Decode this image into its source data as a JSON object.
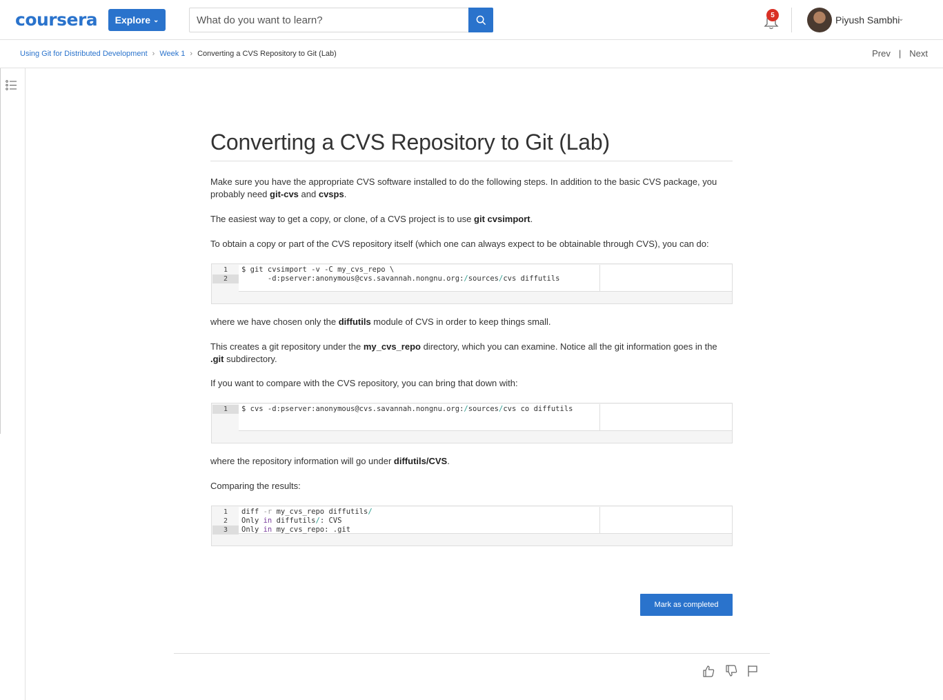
{
  "header": {
    "logo": "coursera",
    "explore_label": "Explore",
    "search_placeholder": "What do you want to learn?",
    "notifications_count": "5",
    "user_name": "Piyush Sambhi"
  },
  "breadcrumb": {
    "items": [
      "Using Git for Distributed Development",
      "Week 1"
    ],
    "current": "Converting a CVS Repository to Git (Lab)",
    "prev_label": "Prev",
    "separator": "|",
    "next_label": "Next"
  },
  "content": {
    "title": "Converting a CVS Repository to Git (Lab)",
    "p1_a": "Make sure you have the appropriate CVS software installed to do the following steps. In addition to the basic CVS package, you probably need ",
    "p1_b1": "git-cvs",
    "p1_c": " and ",
    "p1_b2": "cvsps",
    "p1_d": ".",
    "p2_a": "The easiest way to get a copy, or clone, of a CVS project is to use ",
    "p2_b": "git cvsimport",
    "p2_c": ".",
    "p3": "To obtain a copy or part of the CVS repository itself (which one can always expect to be obtainable through CVS), you can do:",
    "code1": {
      "line_numbers": [
        "1",
        "2"
      ],
      "line1": "$ git cvsimport -v -C my_cvs_repo \\",
      "line2_a": "      -d:pserver:anonymous@cvs.savannah.nongnu.org:",
      "line2_b": "/",
      "line2_c": "sources",
      "line2_d": "/",
      "line2_e": "cvs diffutils"
    },
    "p4_a": "where we have chosen only the ",
    "p4_b": "diffutils",
    "p4_c": " module of CVS in order to keep things small.",
    "p5_a": "This creates a git repository under the ",
    "p5_b": "my_cvs_repo",
    "p5_c": " directory, which you can examine. Notice all the git information goes in the ",
    "p5_d": ".git",
    "p5_e": " subdirectory.",
    "p6": "If you want to compare with the CVS repository, you can bring that down with:",
    "code2": {
      "line_numbers": [
        "1"
      ],
      "line1_a": "$ cvs -d:pserver:anonymous@cvs.savannah.nongnu.org:",
      "line1_b": "/",
      "line1_c": "sources",
      "line1_d": "/",
      "line1_e": "cvs co diffutils"
    },
    "p7_a": "where the repository information will go under ",
    "p7_b": "diffutils/CVS",
    "p7_c": ".",
    "p8": "Comparing the results:",
    "code3": {
      "line_numbers": [
        "1",
        "2",
        "3"
      ],
      "l1_a": "diff ",
      "l1_b": "-r",
      "l1_c": " my_cvs_repo diffutils",
      "l1_d": "/",
      "l2_a": "Only ",
      "l2_b": "in",
      "l2_c": " diffutils",
      "l2_d": "/",
      "l2_e": ": CVS",
      "l3_a": "Only ",
      "l3_b": "in",
      "l3_c": " my_cvs_repo: .git"
    },
    "mark_completed_label": "Mark as completed"
  },
  "icons": {
    "search": "search-icon",
    "bell": "bell-icon",
    "toc": "list-icon",
    "like": "thumbs-up-icon",
    "dislike": "thumbs-down-icon",
    "flag": "flag-icon"
  },
  "colors": {
    "brand": "#2a73cc",
    "badge": "#d93025"
  }
}
